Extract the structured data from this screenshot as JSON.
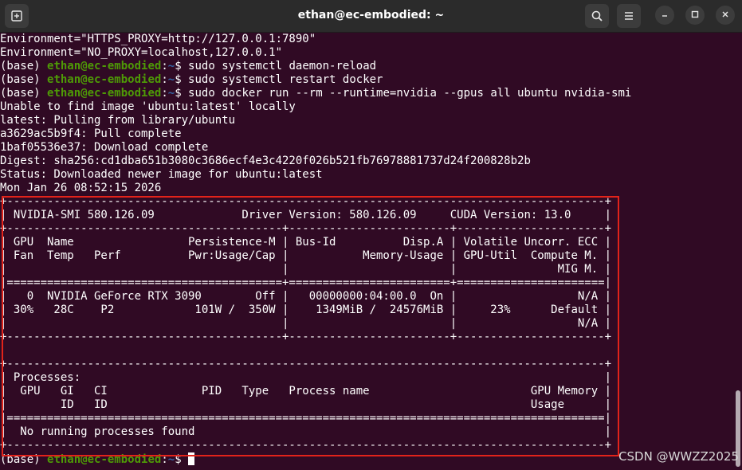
{
  "window": {
    "title": "ethan@ec-embodied: ~"
  },
  "icons": {
    "new_tab": "new-tab-icon",
    "search": "search-icon",
    "menu": "hamburger-menu-icon",
    "minimize": "minimize-icon",
    "maximize": "maximize-icon",
    "close": "close-icon"
  },
  "colors": {
    "terminal_bg": "#300a24",
    "titlebar_bg": "#2b2b2b",
    "prompt_user": "#4e9a06",
    "prompt_path": "#3465a4",
    "highlight_box": "#e2231a"
  },
  "prompt": {
    "env": "(base) ",
    "user_host": "ethan@ec-embodied",
    "colon": ":",
    "path": "~",
    "dollar": "$ "
  },
  "terminal": {
    "line01": "Environment=\"HTTPS_PROXY=http://127.0.0.1:7890\"",
    "line02": "Environment=\"NO_PROXY=localhost,127.0.0.1\"",
    "cmd03": "sudo systemctl daemon-reload",
    "cmd04": "sudo systemctl restart docker",
    "cmd05": "sudo docker run --rm --runtime=nvidia --gpus all ubuntu nvidia-smi",
    "line06": "Unable to find image 'ubuntu:latest' locally",
    "line07": "latest: Pulling from library/ubuntu",
    "line08": "a3629ac5b9f4: Pull complete",
    "line09": "1baf05536e37: Download complete",
    "line10": "Digest: sha256:cd1dba651b3080c3686ecf4e3c4220f026b521fb76978881737d24f200828b2b",
    "line11": "Status: Downloaded newer image for ubuntu:latest",
    "line12": "Mon Jan 26 08:52:15 2026",
    "line13": "+-----------------------------------------------------------------------------------------+",
    "line14": "| NVIDIA-SMI 580.126.09             Driver Version: 580.126.09     CUDA Version: 13.0     |",
    "line15": "+-----------------------------------------+------------------------+----------------------+",
    "line16": "| GPU  Name                 Persistence-M | Bus-Id          Disp.A | Volatile Uncorr. ECC |",
    "line17": "| Fan  Temp   Perf          Pwr:Usage/Cap |           Memory-Usage | GPU-Util  Compute M. |",
    "line18": "|                                         |                        |               MIG M. |",
    "line19": "|=========================================+========================+======================|",
    "line20": "|   0  NVIDIA GeForce RTX 3090        Off |   00000000:04:00.0  On |                  N/A |",
    "line21": "| 30%   28C    P2            101W /  350W |    1349MiB /  24576MiB |     23%      Default |",
    "line22": "|                                         |                        |                  N/A |",
    "line23": "+-----------------------------------------+------------------------+----------------------+",
    "line24": "",
    "line25": "+-----------------------------------------------------------------------------------------+",
    "line26": "| Processes:                                                                              |",
    "line27": "|  GPU   GI   CI              PID   Type   Process name                        GPU Memory |",
    "line28": "|        ID   ID                                                               Usage      |",
    "line29": "|=========================================================================================|",
    "line30": "|  No running processes found                                                             |",
    "line31": "+-----------------------------------------------------------------------------------------+"
  },
  "watermark": "CSDN @WWZZ2025"
}
